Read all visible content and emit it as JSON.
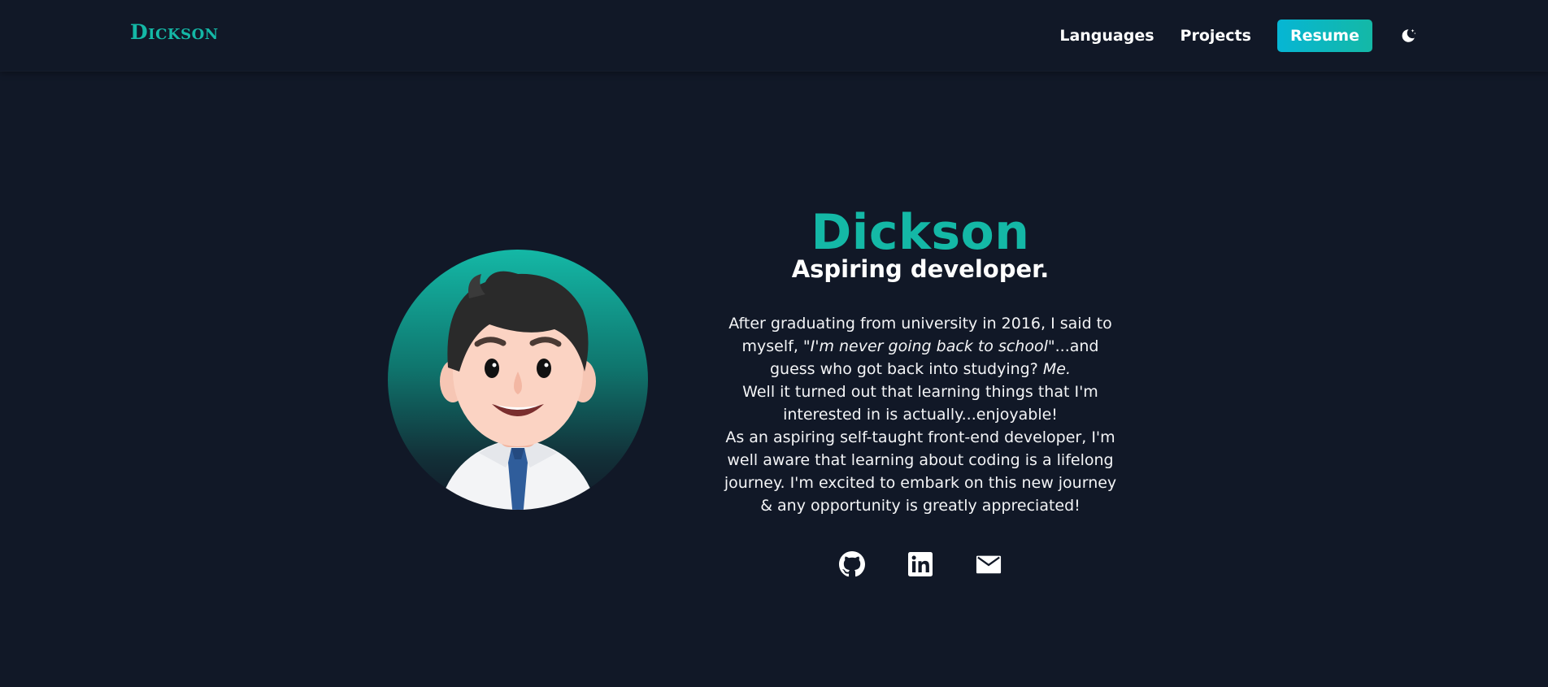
{
  "nav": {
    "logo": "Dickson",
    "links": [
      "Languages",
      "Projects"
    ],
    "resume_label": "Resume",
    "theme_toggle_icon": "moon-stars-icon"
  },
  "hero": {
    "name": "Dickson",
    "tagline": "Aspiring developer.",
    "bio": {
      "p1_a": "After graduating from university in 2016, I said to myself, ",
      "p1_quote": "\"I'm never going back to school\"",
      "p1_b": "...and guess who got back into studying? ",
      "p1_me": "Me.",
      "p2": "Well it turned out that learning things that I'm interested in is actually...enjoyable!",
      "p3": "As an aspiring self-taught front-end developer, I'm well aware that learning about coding is a lifelong journey. I'm excited to embark on this new journey & any opportunity is greatly appreciated!"
    },
    "socials": [
      {
        "icon": "github-icon"
      },
      {
        "icon": "linkedin-icon"
      },
      {
        "icon": "mail-icon"
      }
    ]
  },
  "colors": {
    "background": "#111827",
    "accent": "#14b8a6",
    "resume_gradient_start": "#06b6d4",
    "text": "#ffffff"
  }
}
